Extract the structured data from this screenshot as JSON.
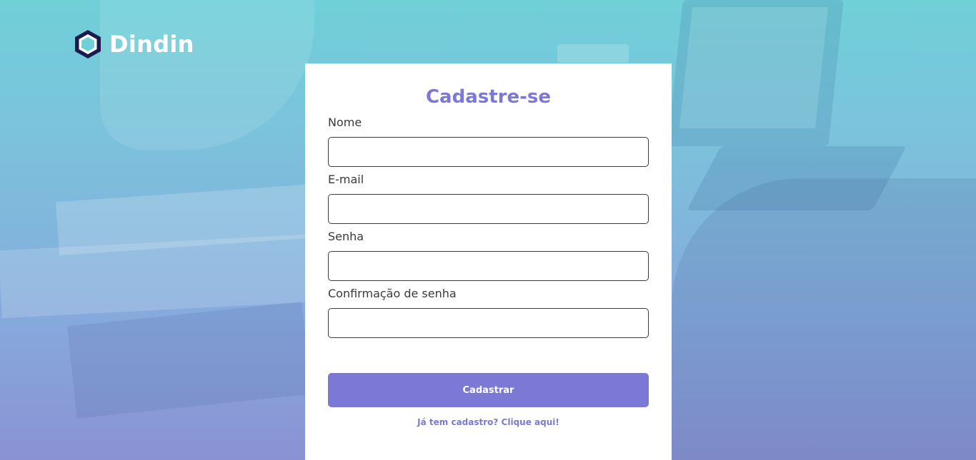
{
  "brand": {
    "name": "Dindin",
    "logo_icon": "hexagon-logo-icon"
  },
  "form": {
    "title": "Cadastre-se",
    "fields": [
      {
        "label": "Nome",
        "value": "",
        "placeholder": ""
      },
      {
        "label": "E-mail",
        "value": "",
        "placeholder": ""
      },
      {
        "label": "Senha",
        "value": "",
        "placeholder": ""
      },
      {
        "label": "Confirmação de senha",
        "value": "",
        "placeholder": ""
      }
    ],
    "submit_label": "Cadastrar",
    "login_link": "Já tem cadastro? Clique aqui!"
  },
  "colors": {
    "accent": "#7b78d6",
    "logo_dark": "#1a1a4e",
    "logo_fill": "#6fd0d8",
    "text": "#3a3a3a",
    "card_background": "#ffffff"
  }
}
